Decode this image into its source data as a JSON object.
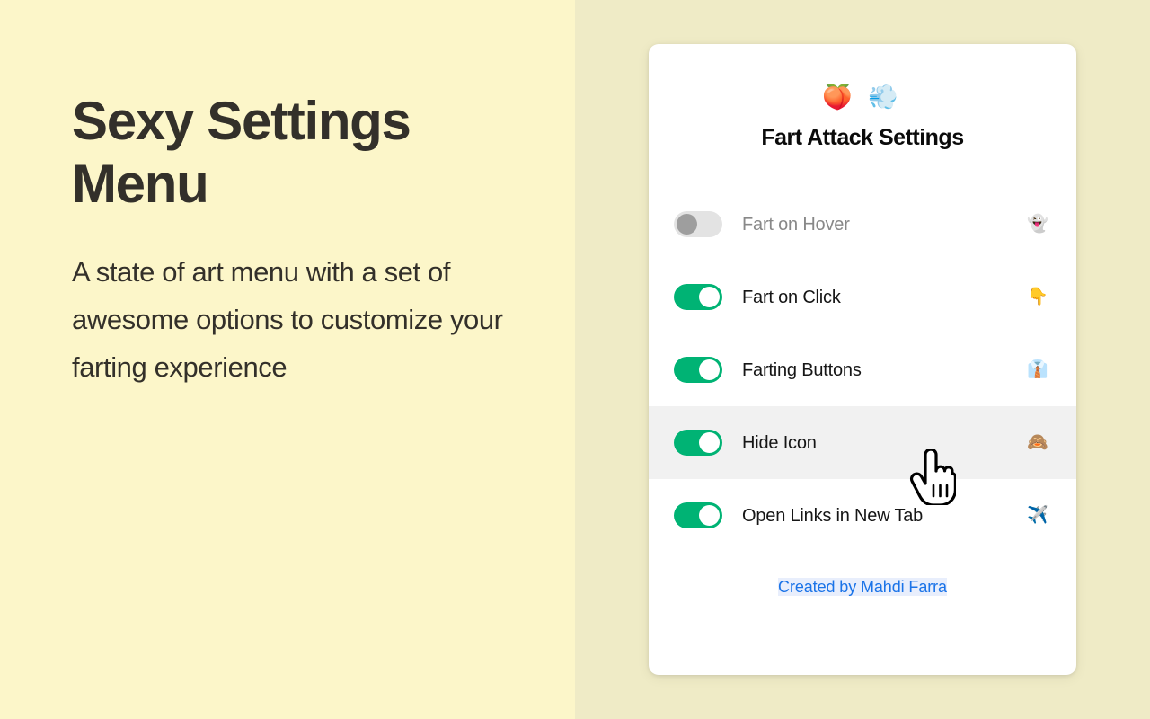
{
  "promo": {
    "heading": "Sexy Settings Menu",
    "body": "A state of art menu with a set of awesome options to customize your farting experience"
  },
  "card": {
    "header_emoji": "🍑 💨",
    "title": "Fart Attack Settings",
    "rows": [
      {
        "label": "Fart on Hover",
        "emoji": "👻",
        "emoji_name": "ghost-icon",
        "enabled": false,
        "hovered": false
      },
      {
        "label": "Fart on Click",
        "emoji": "👇",
        "emoji_name": "pointing-down-icon",
        "enabled": true,
        "hovered": false
      },
      {
        "label": "Farting Buttons",
        "emoji": "👔",
        "emoji_name": "necktie-icon",
        "enabled": true,
        "hovered": false
      },
      {
        "label": "Hide Icon",
        "emoji": "🙈",
        "emoji_name": "see-no-evil-monkey-icon",
        "enabled": true,
        "hovered": true
      },
      {
        "label": "Open Links in New Tab",
        "emoji": "✈️",
        "emoji_name": "airplane-icon",
        "enabled": true,
        "hovered": false
      }
    ],
    "credit": "Created by Mahdi Farra"
  },
  "cursor": {
    "type": "pointing-hand-cursor"
  },
  "colors": {
    "bg_left": "#FCF6C9",
    "bg_right": "#EFEBC6",
    "card": "#FFFFFF",
    "toggle_on": "#00B374",
    "toggle_off_track": "#E3E3E3",
    "toggle_off_knob": "#9E9E9E",
    "row_hover": "#F1F1F1",
    "link": "#1A73E8",
    "heading_text": "#33302A",
    "label_text": "#161616",
    "label_disabled_text": "#888888"
  }
}
